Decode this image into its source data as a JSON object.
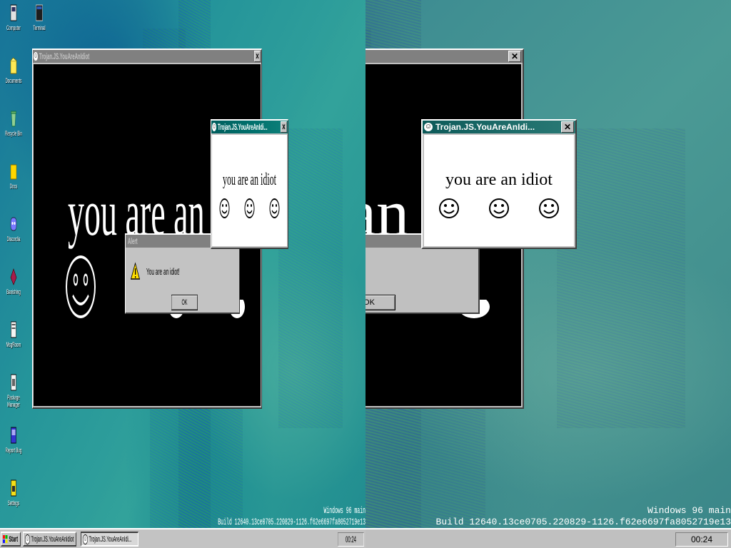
{
  "desktop": {
    "icons": [
      {
        "label": "Computer",
        "icon": "computer-icon"
      },
      {
        "label": "Terminal",
        "icon": "terminal-icon"
      },
      {
        "label": "Documents",
        "icon": "documents-icon"
      },
      {
        "label": "Recycle Bin",
        "icon": "recycle-bin-icon"
      },
      {
        "label": "Docs",
        "icon": "folder-icon"
      },
      {
        "label": "Discordia",
        "icon": "discord-icon"
      },
      {
        "label": "Banishing",
        "icon": "banishing-icon"
      },
      {
        "label": "MsgRoom",
        "icon": "msgroom-icon"
      },
      {
        "label": "Package Manager",
        "icon": "package-manager-icon"
      },
      {
        "label": "Report Bug",
        "icon": "report-bug-icon"
      },
      {
        "label": "Settings",
        "icon": "settings-icon"
      }
    ],
    "build_line1": "Windows 96 main",
    "build_line2": "Build 12640.13ce0705.220829-1126.f62e6697fa8052719e13"
  },
  "big_window": {
    "title": "Trojan.JS.YouAreAnIdiot",
    "text": "you are an idiot"
  },
  "small_window": {
    "title": "Trojan.JS.YouAreAnIdi...",
    "text": "you are an idiot"
  },
  "alert": {
    "title": "Alert",
    "message": "You are an idiot!",
    "ok_label": "OK"
  },
  "taskbar": {
    "start_label": "Start",
    "task1": "Trojan.JS.YouAreAnIdiot",
    "task2": "Trojan.JS.YouAreAnIdi...",
    "clock": "00:24"
  },
  "colors": {
    "titlebar": "#0d5a59",
    "desktop": "#3f8e92"
  }
}
